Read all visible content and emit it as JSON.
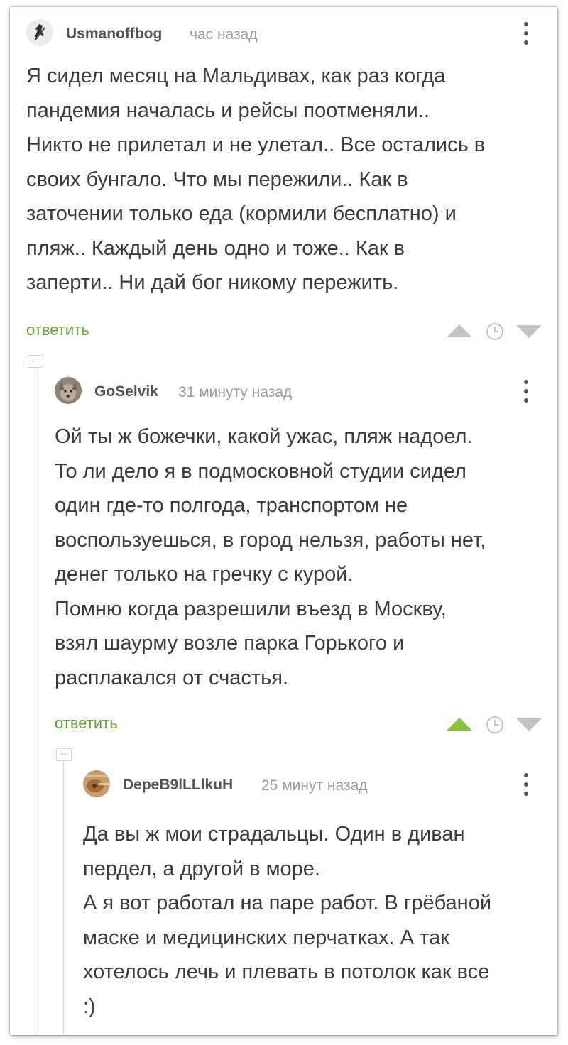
{
  "colors": {
    "reply_link": "#6a9f3c",
    "vote_up_active": "#8ac13f",
    "vote_inactive": "#c4c4c4",
    "username": "#545454",
    "timestamp": "#9b9b9b"
  },
  "comments": [
    {
      "username": "Usmanoffbog",
      "time": "час назад",
      "avatar_icon": "user-avatar-icon",
      "lines": [
        "Я сидел месяц на Мальдивах, как раз когда",
        "пандемия началась и рейсы поотменяли..",
        "Никто не прилетал и не улетал.. Все остались в",
        "своих бунгало. Что мы пережили.. Как в",
        "заточении только еда (кормили бесплатно) и",
        "пляж.. Каждый день одно и тоже.. Как в",
        "заперти.. Ни дай бог никому пережить."
      ],
      "reply_label": "ответить",
      "upvoted": false
    },
    {
      "username": "GoSelvik",
      "time": "31 минуту назад",
      "avatar_icon": "user-avatar-icon",
      "lines": [
        "Ой ты ж божечки, какой ужас, пляж надоел.",
        "То ли дело я в подмосковной студии сидел",
        "один где-то полгода, транспортом не",
        "воспользуешься, в город нельзя, работы нет,",
        "денег только на гречку с курой.",
        "Помню когда разрешили въезд в Москву,",
        "взял шаурму возле парка Горького и",
        "расплакался от счастья."
      ],
      "reply_label": "ответить",
      "upvoted": true
    },
    {
      "username": "DepeB9lLLlkuH",
      "time": "25 минут назад",
      "avatar_icon": "user-avatar-icon",
      "lines": [
        "Да вы ж мои страдальцы. Один в диван",
        "пердел, а другой в море.",
        "А я вот работал на паре работ. В грёбаной",
        "маске и медицинских перчатках. А так",
        "хотелось лечь и плевать в потолок как все",
        ":)"
      ]
    }
  ]
}
